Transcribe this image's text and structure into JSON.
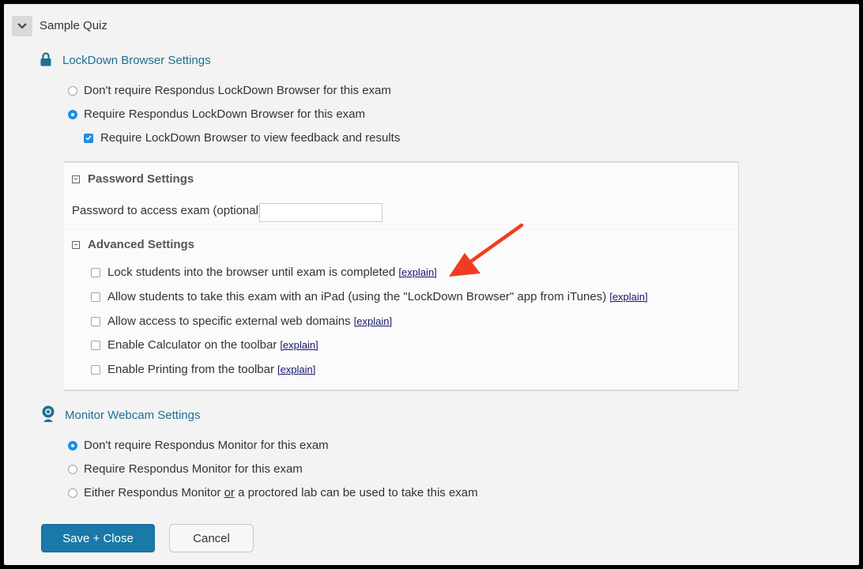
{
  "quiz": {
    "title": "Sample Quiz"
  },
  "lockdown": {
    "title": "LockDown Browser Settings",
    "options": [
      {
        "label": "Don't require Respondus LockDown Browser for this exam",
        "selected": false
      },
      {
        "label": "Require Respondus LockDown Browser for this exam",
        "selected": true
      }
    ],
    "feedback_checkbox": {
      "label": "Require LockDown Browser to view feedback and results",
      "checked": true
    }
  },
  "password": {
    "title": "Password Settings",
    "field_label": "Password to access exam (optional)",
    "value": ""
  },
  "advanced": {
    "title": "Advanced Settings",
    "explain_label": "[explain]",
    "items": [
      {
        "label": "Lock students into the browser until exam is completed",
        "checked": false
      },
      {
        "label": "Allow students to take this exam with an iPad (using the \"LockDown Browser\" app from iTunes)",
        "checked": false
      },
      {
        "label": "Allow access to specific external web domains",
        "checked": false
      },
      {
        "label": "Enable Calculator on the toolbar",
        "checked": false
      },
      {
        "label": "Enable Printing from the toolbar",
        "checked": false
      }
    ]
  },
  "webcam": {
    "title": "Monitor Webcam Settings",
    "options": [
      {
        "label": "Don't require Respondus Monitor for this exam",
        "selected": true
      },
      {
        "label": "Require Respondus Monitor for this exam",
        "selected": false
      }
    ],
    "either_option": {
      "prefix": "Either Respondus Monitor ",
      "underlined": "or",
      "suffix": " a proctored lab can be used to take this exam",
      "selected": false
    }
  },
  "buttons": {
    "save": "Save + Close",
    "cancel": "Cancel"
  },
  "colors": {
    "accent": "#1a79a8",
    "link": "#1c6f93",
    "arrow": "#f03c22",
    "radio_on": "#1b8fe6"
  }
}
